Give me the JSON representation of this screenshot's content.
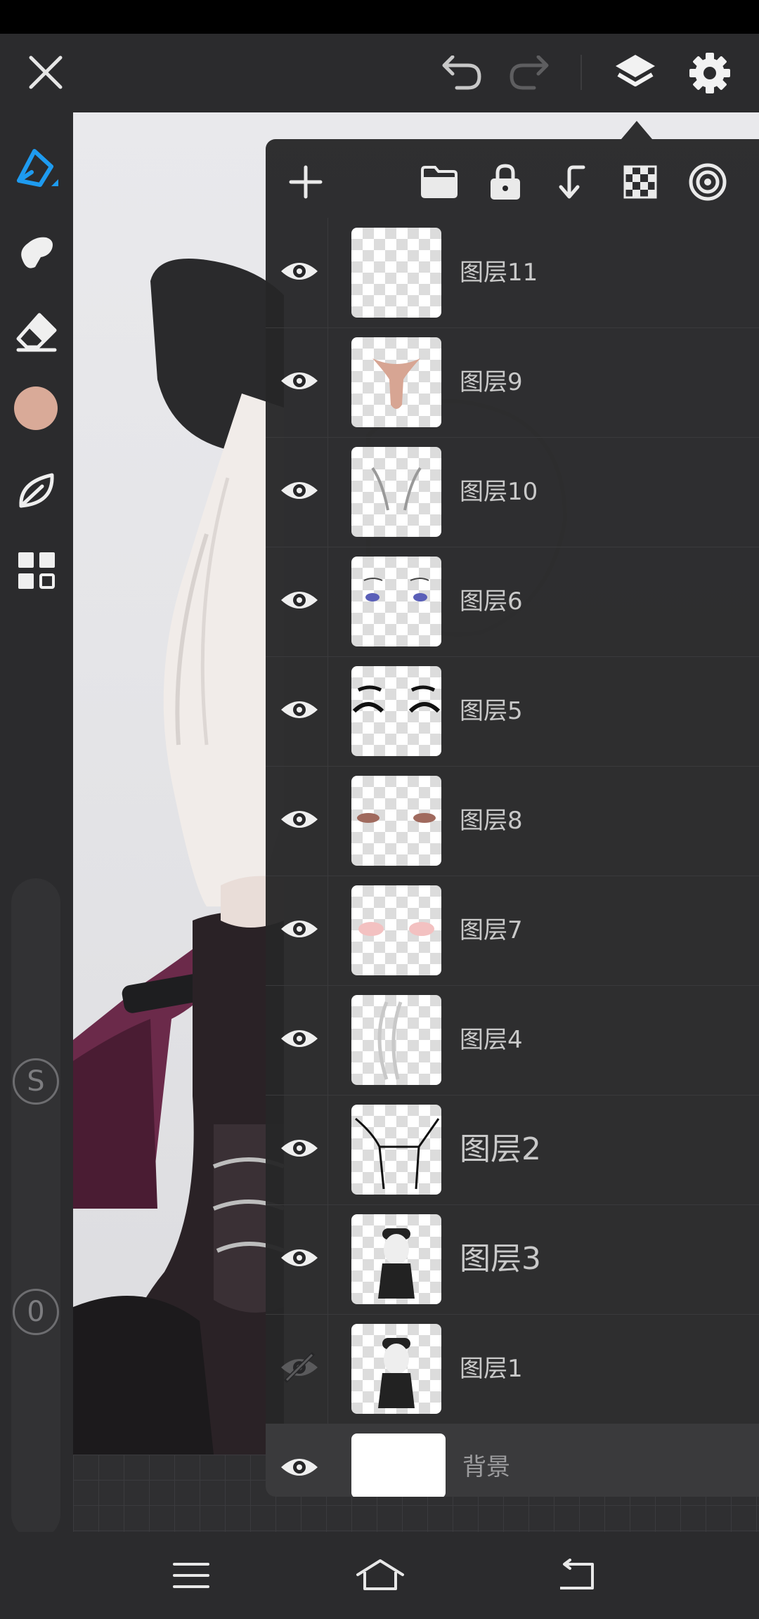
{
  "toolbar": {
    "brush_color": "#d9aa98",
    "accent_color": "#1e9bf0"
  },
  "side_buttons": {
    "s_label": "S",
    "zero_label": "0"
  },
  "layer_toolbar": {
    "icons": [
      "add-icon",
      "folder-icon",
      "lock-icon",
      "merge-down-icon",
      "transparency-icon",
      "target-icon"
    ]
  },
  "layers": [
    {
      "name": "图层11",
      "visible": true
    },
    {
      "name": "图层9",
      "visible": true
    },
    {
      "name": "图层10",
      "visible": true
    },
    {
      "name": "图层6",
      "visible": true
    },
    {
      "name": "图层5",
      "visible": true
    },
    {
      "name": "图层8",
      "visible": true
    },
    {
      "name": "图层7",
      "visible": true
    },
    {
      "name": "图层4",
      "visible": true
    },
    {
      "name": "图层2",
      "visible": true
    },
    {
      "name": "图层3",
      "visible": true
    },
    {
      "name": "图层1",
      "visible": false
    },
    {
      "name": "背景",
      "visible": true
    }
  ]
}
